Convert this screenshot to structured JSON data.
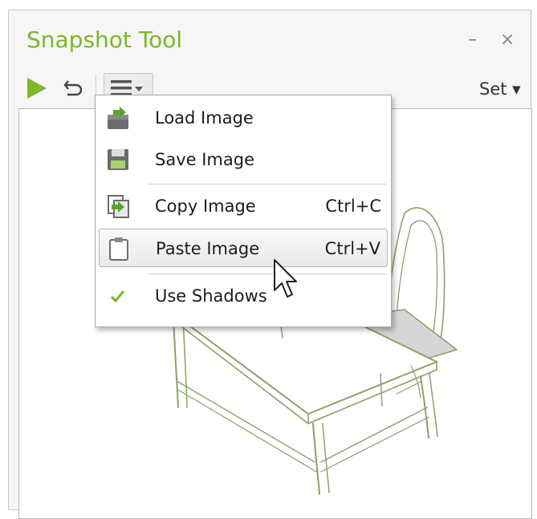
{
  "panel": {
    "title": "Snapshot Tool",
    "minimize_glyph": "–",
    "close_glyph": "×"
  },
  "toolbar": {
    "play_icon": "play-icon",
    "undo_icon": "undo-icon",
    "menu_icon": "hamburger-menu-icon",
    "set_label": "Set ▾"
  },
  "menu": {
    "items": [
      {
        "label": "Load Image",
        "shortcut": "",
        "icon": "load-image-icon"
      },
      {
        "label": "Save Image",
        "shortcut": "",
        "icon": "floppy-disk-icon"
      },
      {
        "label": "Copy Image",
        "shortcut": "Ctrl+C",
        "icon": "copy-image-icon"
      },
      {
        "label": "Paste Image",
        "shortcut": "Ctrl+V",
        "icon": "clipboard-icon"
      },
      {
        "label": "Use Shadows",
        "shortcut": "",
        "icon": "checkmark-icon"
      }
    ],
    "highlighted": "Paste Image",
    "use_shadows_checked": true
  },
  "colors": {
    "accent_green": "#7cb827",
    "sketch_green": "#8ea06a",
    "seat_gray": "#d6d6d6"
  }
}
